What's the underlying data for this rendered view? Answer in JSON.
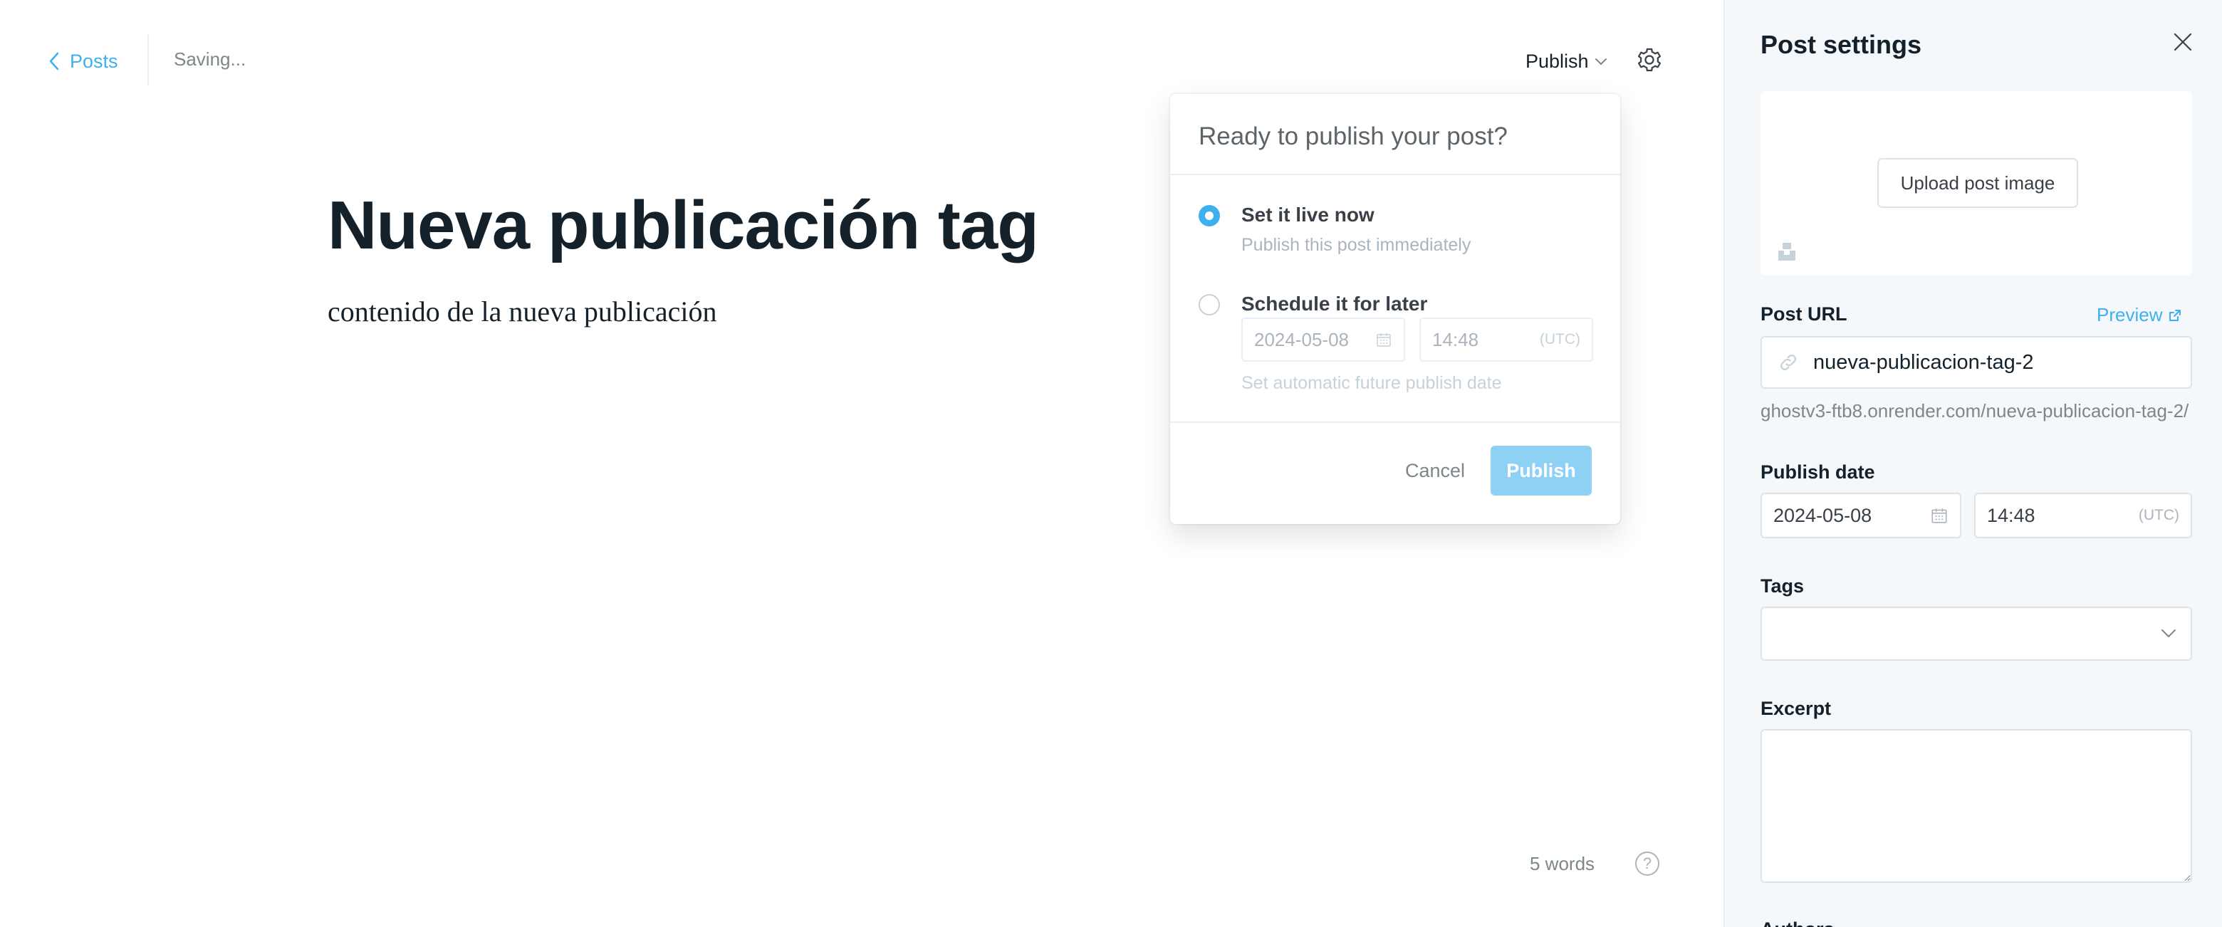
{
  "header": {
    "back_label": "Posts",
    "status": "Saving...",
    "publish_menu_label": "Publish"
  },
  "editor": {
    "title": "Nueva publicación tag",
    "body": "contenido de la nueva publicación",
    "word_count": "5 words",
    "help_symbol": "?"
  },
  "publish_menu": {
    "heading": "Ready to publish your post?",
    "option_now": {
      "label": "Set it live now",
      "description": "Publish this post immediately",
      "selected": true
    },
    "option_schedule": {
      "label": "Schedule it for later",
      "date": "2024-05-08",
      "time": "14:48",
      "timezone": "(UTC)",
      "note": "Set automatic future publish date",
      "selected": false
    },
    "cancel_label": "Cancel",
    "publish_label": "Publish"
  },
  "sidebar": {
    "title": "Post settings",
    "upload_label": "Upload post image",
    "post_url": {
      "label": "Post URL",
      "preview_label": "Preview",
      "slug": "nueva-publicacion-tag-2",
      "full_url": "ghostv3-ftb8.onrender.com/nueva-publicacion-tag-2/"
    },
    "publish_date": {
      "label": "Publish date",
      "date": "2024-05-08",
      "time": "14:48",
      "timezone": "(UTC)"
    },
    "tags_label": "Tags",
    "excerpt_label": "Excerpt",
    "authors_label": "Authors"
  },
  "colors": {
    "accent": "#3eb0ef",
    "publish_button_disabled": "#8fd0f5",
    "sidebar_bg": "#f4f8fb",
    "text_dark": "#15212a",
    "text_muted": "#7d878a"
  }
}
